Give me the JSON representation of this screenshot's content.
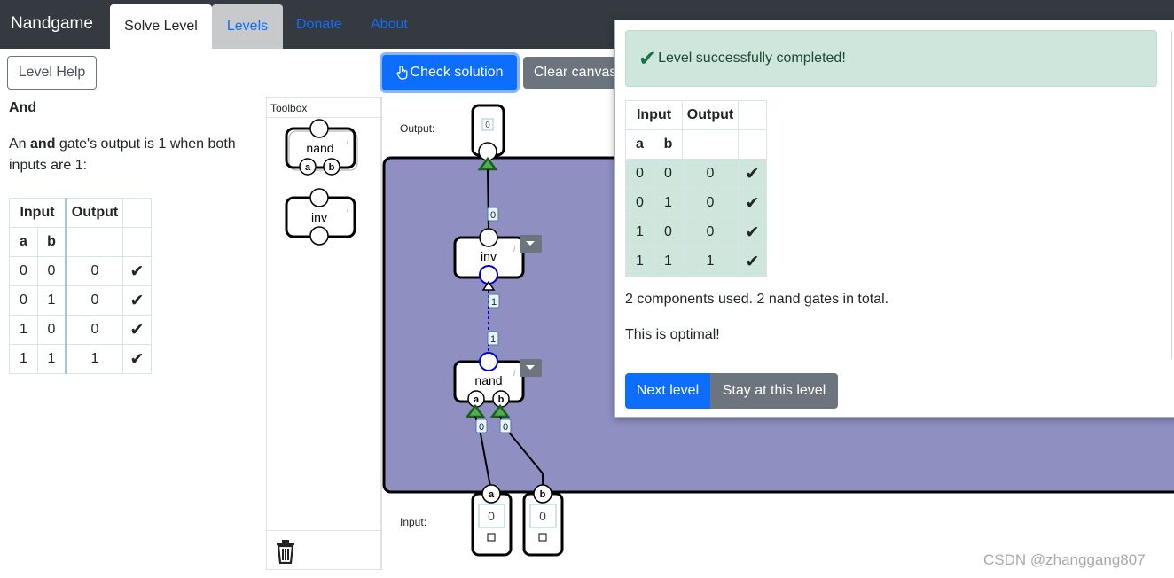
{
  "nav": {
    "brand": "Nandgame",
    "tabs": [
      {
        "label": "Solve Level"
      },
      {
        "label": "Levels"
      }
    ],
    "links": [
      {
        "label": "Donate"
      },
      {
        "label": "About"
      }
    ]
  },
  "left": {
    "help_button": "Level Help",
    "title": "And",
    "desc_prefix": "An ",
    "desc_bold": "and",
    "desc_suffix": " gate's output is 1 when both inputs are 1:",
    "table": {
      "header_input": "Input",
      "header_output": "Output",
      "col_a": "a",
      "col_b": "b",
      "rows": [
        {
          "a": "0",
          "b": "0",
          "out": "0",
          "check": "✔"
        },
        {
          "a": "0",
          "b": "1",
          "out": "0",
          "check": "✔"
        },
        {
          "a": "1",
          "b": "0",
          "out": "0",
          "check": "✔"
        },
        {
          "a": "1",
          "b": "1",
          "out": "1",
          "check": "✔"
        }
      ]
    }
  },
  "toolbox": {
    "title": "Toolbox",
    "items": [
      {
        "label": "nand",
        "pin_a": "a",
        "pin_b": "b"
      },
      {
        "label": "inv"
      }
    ]
  },
  "toolbar": {
    "check_label": "Check solution",
    "clear_label": "Clear canvas"
  },
  "canvas": {
    "output_label": "Output:",
    "input_label": "Input:",
    "output_value": "0",
    "input_a_value": "0",
    "input_b_value": "0",
    "pin_a": "a",
    "pin_b": "b",
    "inv_label": "inv",
    "nand_label": "nand",
    "wire_values": {
      "out_wire": "0",
      "mid_wire_upper": "1",
      "mid_wire_lower": "1",
      "a_wire": "0",
      "b_wire": "0"
    },
    "colors": {
      "board": "#8f8fc1",
      "active_wire": "#0000cc",
      "pin_ok": "#2e7d32"
    }
  },
  "dialog": {
    "success": "Level successfully completed!",
    "table": {
      "header_input": "Input",
      "header_output": "Output",
      "col_a": "a",
      "col_b": "b",
      "rows": [
        {
          "a": "0",
          "b": "0",
          "out": "0",
          "check": "✔"
        },
        {
          "a": "0",
          "b": "1",
          "out": "0",
          "check": "✔"
        },
        {
          "a": "1",
          "b": "0",
          "out": "0",
          "check": "✔"
        },
        {
          "a": "1",
          "b": "1",
          "out": "1",
          "check": "✔"
        }
      ]
    },
    "components_text": "2 components used. 2 nand gates in total.",
    "optimal_text": "This is optimal!",
    "next_button": "Next level",
    "stay_button": "Stay at this level"
  },
  "watermark": "CSDN @zhanggang807"
}
